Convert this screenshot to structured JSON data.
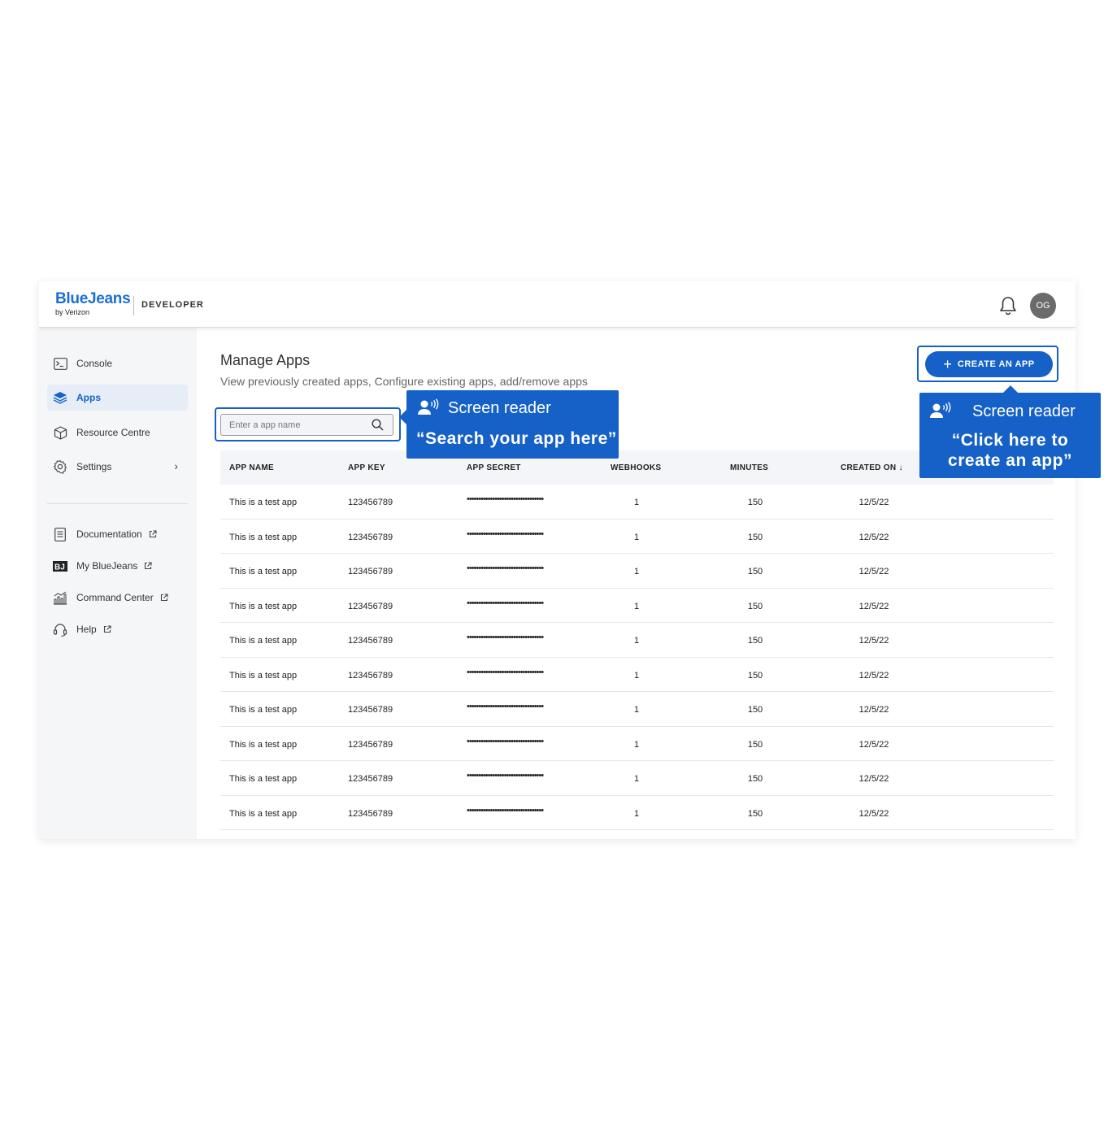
{
  "header": {
    "brand_name": "BlueJeans",
    "brand_sub": "by Verizon",
    "section": "DEVELOPER",
    "avatar_initials": "OG"
  },
  "sidebar": {
    "items": [
      {
        "label": "Console",
        "icon": "terminal-icon"
      },
      {
        "label": "Apps",
        "icon": "layers-icon",
        "active": true
      },
      {
        "label": "Resource Centre",
        "icon": "cube-icon"
      },
      {
        "label": "Settings",
        "icon": "gear-icon"
      }
    ],
    "links": [
      {
        "label": "Documentation",
        "icon": "document-icon"
      },
      {
        "label": "My BlueJeans",
        "icon": "bluejeans-logo-icon"
      },
      {
        "label": "Command Center",
        "icon": "analytics-icon"
      },
      {
        "label": "Help",
        "icon": "headset-icon"
      }
    ]
  },
  "main": {
    "title": "Manage Apps",
    "subtitle": "View previously created apps, Configure existing apps, add/remove apps",
    "search_placeholder": "Enter a app name",
    "create_button": "CREATE AN APP"
  },
  "table": {
    "columns": [
      "APP NAME",
      "APP KEY",
      "APP SECRET",
      "WEBHOOKS",
      "MINUTES",
      "CREATED ON"
    ],
    "rows": [
      [
        "This is a test app",
        "123456789",
        "•••••••••••••••••••••••••••••••••",
        "1",
        "150",
        "12/5/22"
      ],
      [
        "This is a test app",
        "123456789",
        "•••••••••••••••••••••••••••••••••",
        "1",
        "150",
        "12/5/22"
      ],
      [
        "This is a test app",
        "123456789",
        "•••••••••••••••••••••••••••••••••",
        "1",
        "150",
        "12/5/22"
      ],
      [
        "This is a test app",
        "123456789",
        "•••••••••••••••••••••••••••••••••",
        "1",
        "150",
        "12/5/22"
      ],
      [
        "This is a test app",
        "123456789",
        "•••••••••••••••••••••••••••••••••",
        "1",
        "150",
        "12/5/22"
      ],
      [
        "This is a test app",
        "123456789",
        "•••••••••••••••••••••••••••••••••",
        "1",
        "150",
        "12/5/22"
      ],
      [
        "This is a test app",
        "123456789",
        "•••••••••••••••••••••••••••••••••",
        "1",
        "150",
        "12/5/22"
      ],
      [
        "This is a test app",
        "123456789",
        "•••••••••••••••••••••••••••••••••",
        "1",
        "150",
        "12/5/22"
      ],
      [
        "This is a test app",
        "123456789",
        "•••••••••••••••••••••••••••••••••",
        "1",
        "150",
        "12/5/22"
      ],
      [
        "This is a test app",
        "123456789",
        "•••••••••••••••••••••••••••••••••",
        "1",
        "150",
        "12/5/22"
      ]
    ]
  },
  "annotations": {
    "search": {
      "heading": "Screen reader",
      "quote": "“Search your app here”"
    },
    "create": {
      "heading": "Screen reader",
      "quote_line1": "“Click here to",
      "quote_line2": "create an app”"
    }
  },
  "colors": {
    "accent": "#1561c8",
    "brand": "#1a6fd6",
    "sidebar_bg": "#f5f6f8"
  }
}
